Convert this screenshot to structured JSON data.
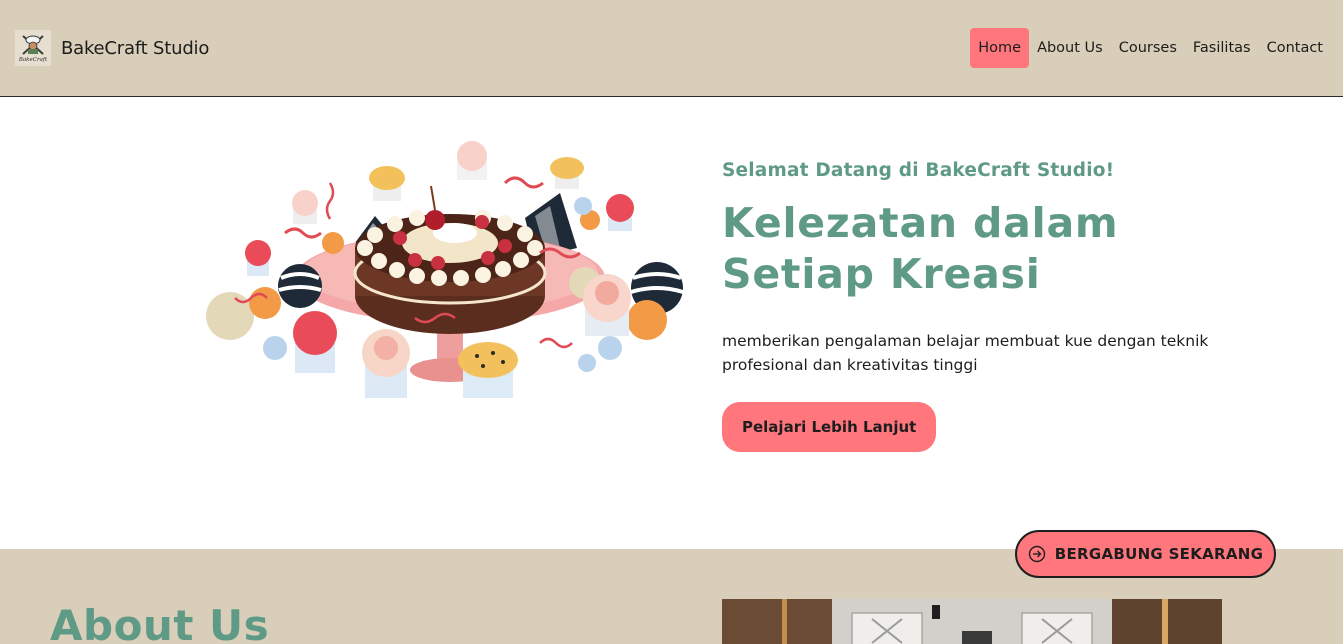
{
  "header": {
    "brand": "BakeCraft Studio",
    "logo_icon": "chef-whisk-logo-icon",
    "logo_text": "BakeCraft"
  },
  "nav": {
    "items": [
      {
        "label": "Home",
        "active": true
      },
      {
        "label": "About Us",
        "active": false
      },
      {
        "label": "Courses",
        "active": false
      },
      {
        "label": "Fasilitas",
        "active": false
      },
      {
        "label": "Contact",
        "active": false
      }
    ]
  },
  "hero": {
    "welcome": "Selamat Datang di BakeCraft Studio!",
    "headline_line1": "Kelezatan dalam",
    "headline_line2": "Setiap Kreasi",
    "description": "memberikan pengalaman belajar membuat kue dengan teknik profesional dan kreativitas tinggi",
    "cta_label": "Pelajari Lebih Lanjut",
    "illustration": "cake-and-cupcakes-illustration"
  },
  "floating": {
    "join_label": "BERGABUNG SEKARANG",
    "join_icon": "arrow-right-circle-icon"
  },
  "about": {
    "title": "About Us",
    "photo": "studio-kitchen-photo"
  },
  "colors": {
    "nav_bg": "#d8ceb9",
    "accent_pink": "#ff767d",
    "accent_green": "#5f9a86",
    "text_dark": "#1d1d1d"
  }
}
